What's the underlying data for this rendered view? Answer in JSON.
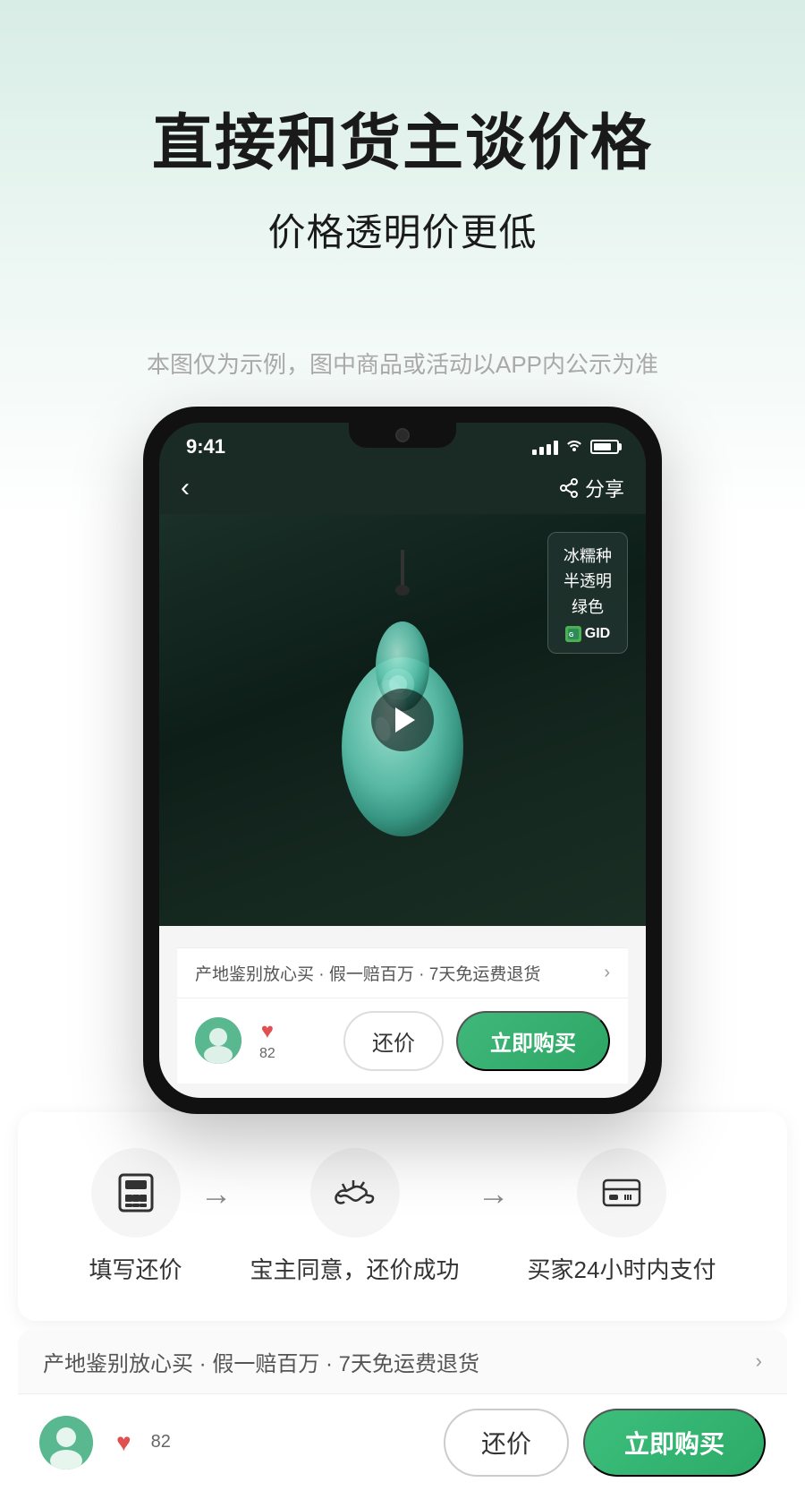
{
  "page": {
    "background_gradient_start": "#d8ede6",
    "background_gradient_end": "#ffffff"
  },
  "header": {
    "main_title": "直接和货主谈价格",
    "sub_title": "价格透明价更低",
    "disclaimer": "本图仅为示例，图中商品或活动以APP内公示为准"
  },
  "phone": {
    "status_bar": {
      "time": "9:41",
      "signal": "4 bars",
      "wifi": "on",
      "battery": "80%"
    },
    "nav": {
      "back_label": "‹",
      "share_label": "分享"
    },
    "product": {
      "cert_lines": [
        "冰糯种",
        "半透明",
        "绿色"
      ],
      "cert_brand": "GID"
    },
    "guarantee_bar": {
      "text": "产地鉴别放心买 · 假一赔百万 · 7天免运费退货",
      "arrow": "›"
    },
    "action_bar": {
      "likes_count": "82",
      "btn_counter_label": "还价",
      "btn_buy_label": "立即购买"
    }
  },
  "process_section": {
    "steps": [
      {
        "id": "step1",
        "label": "填写还价",
        "icon_type": "calculator"
      },
      {
        "id": "step2",
        "label": "宝主同意，还价成功",
        "icon_type": "handshake"
      },
      {
        "id": "step3",
        "label": "买家24小时内支付",
        "icon_type": "payment"
      }
    ]
  },
  "bottom_bar": {
    "guarantee_text": "产地鉴别放心买 · 假一赔百万 · 7天免运费退货",
    "arrow": "›",
    "likes": "82",
    "btn_price": "还价",
    "btn_buy": "立即购买"
  },
  "colors": {
    "accent_green": "#2caa68",
    "text_dark": "#1a1a1a",
    "text_gray": "#aaaaaa",
    "bg_phone": "#111111"
  }
}
